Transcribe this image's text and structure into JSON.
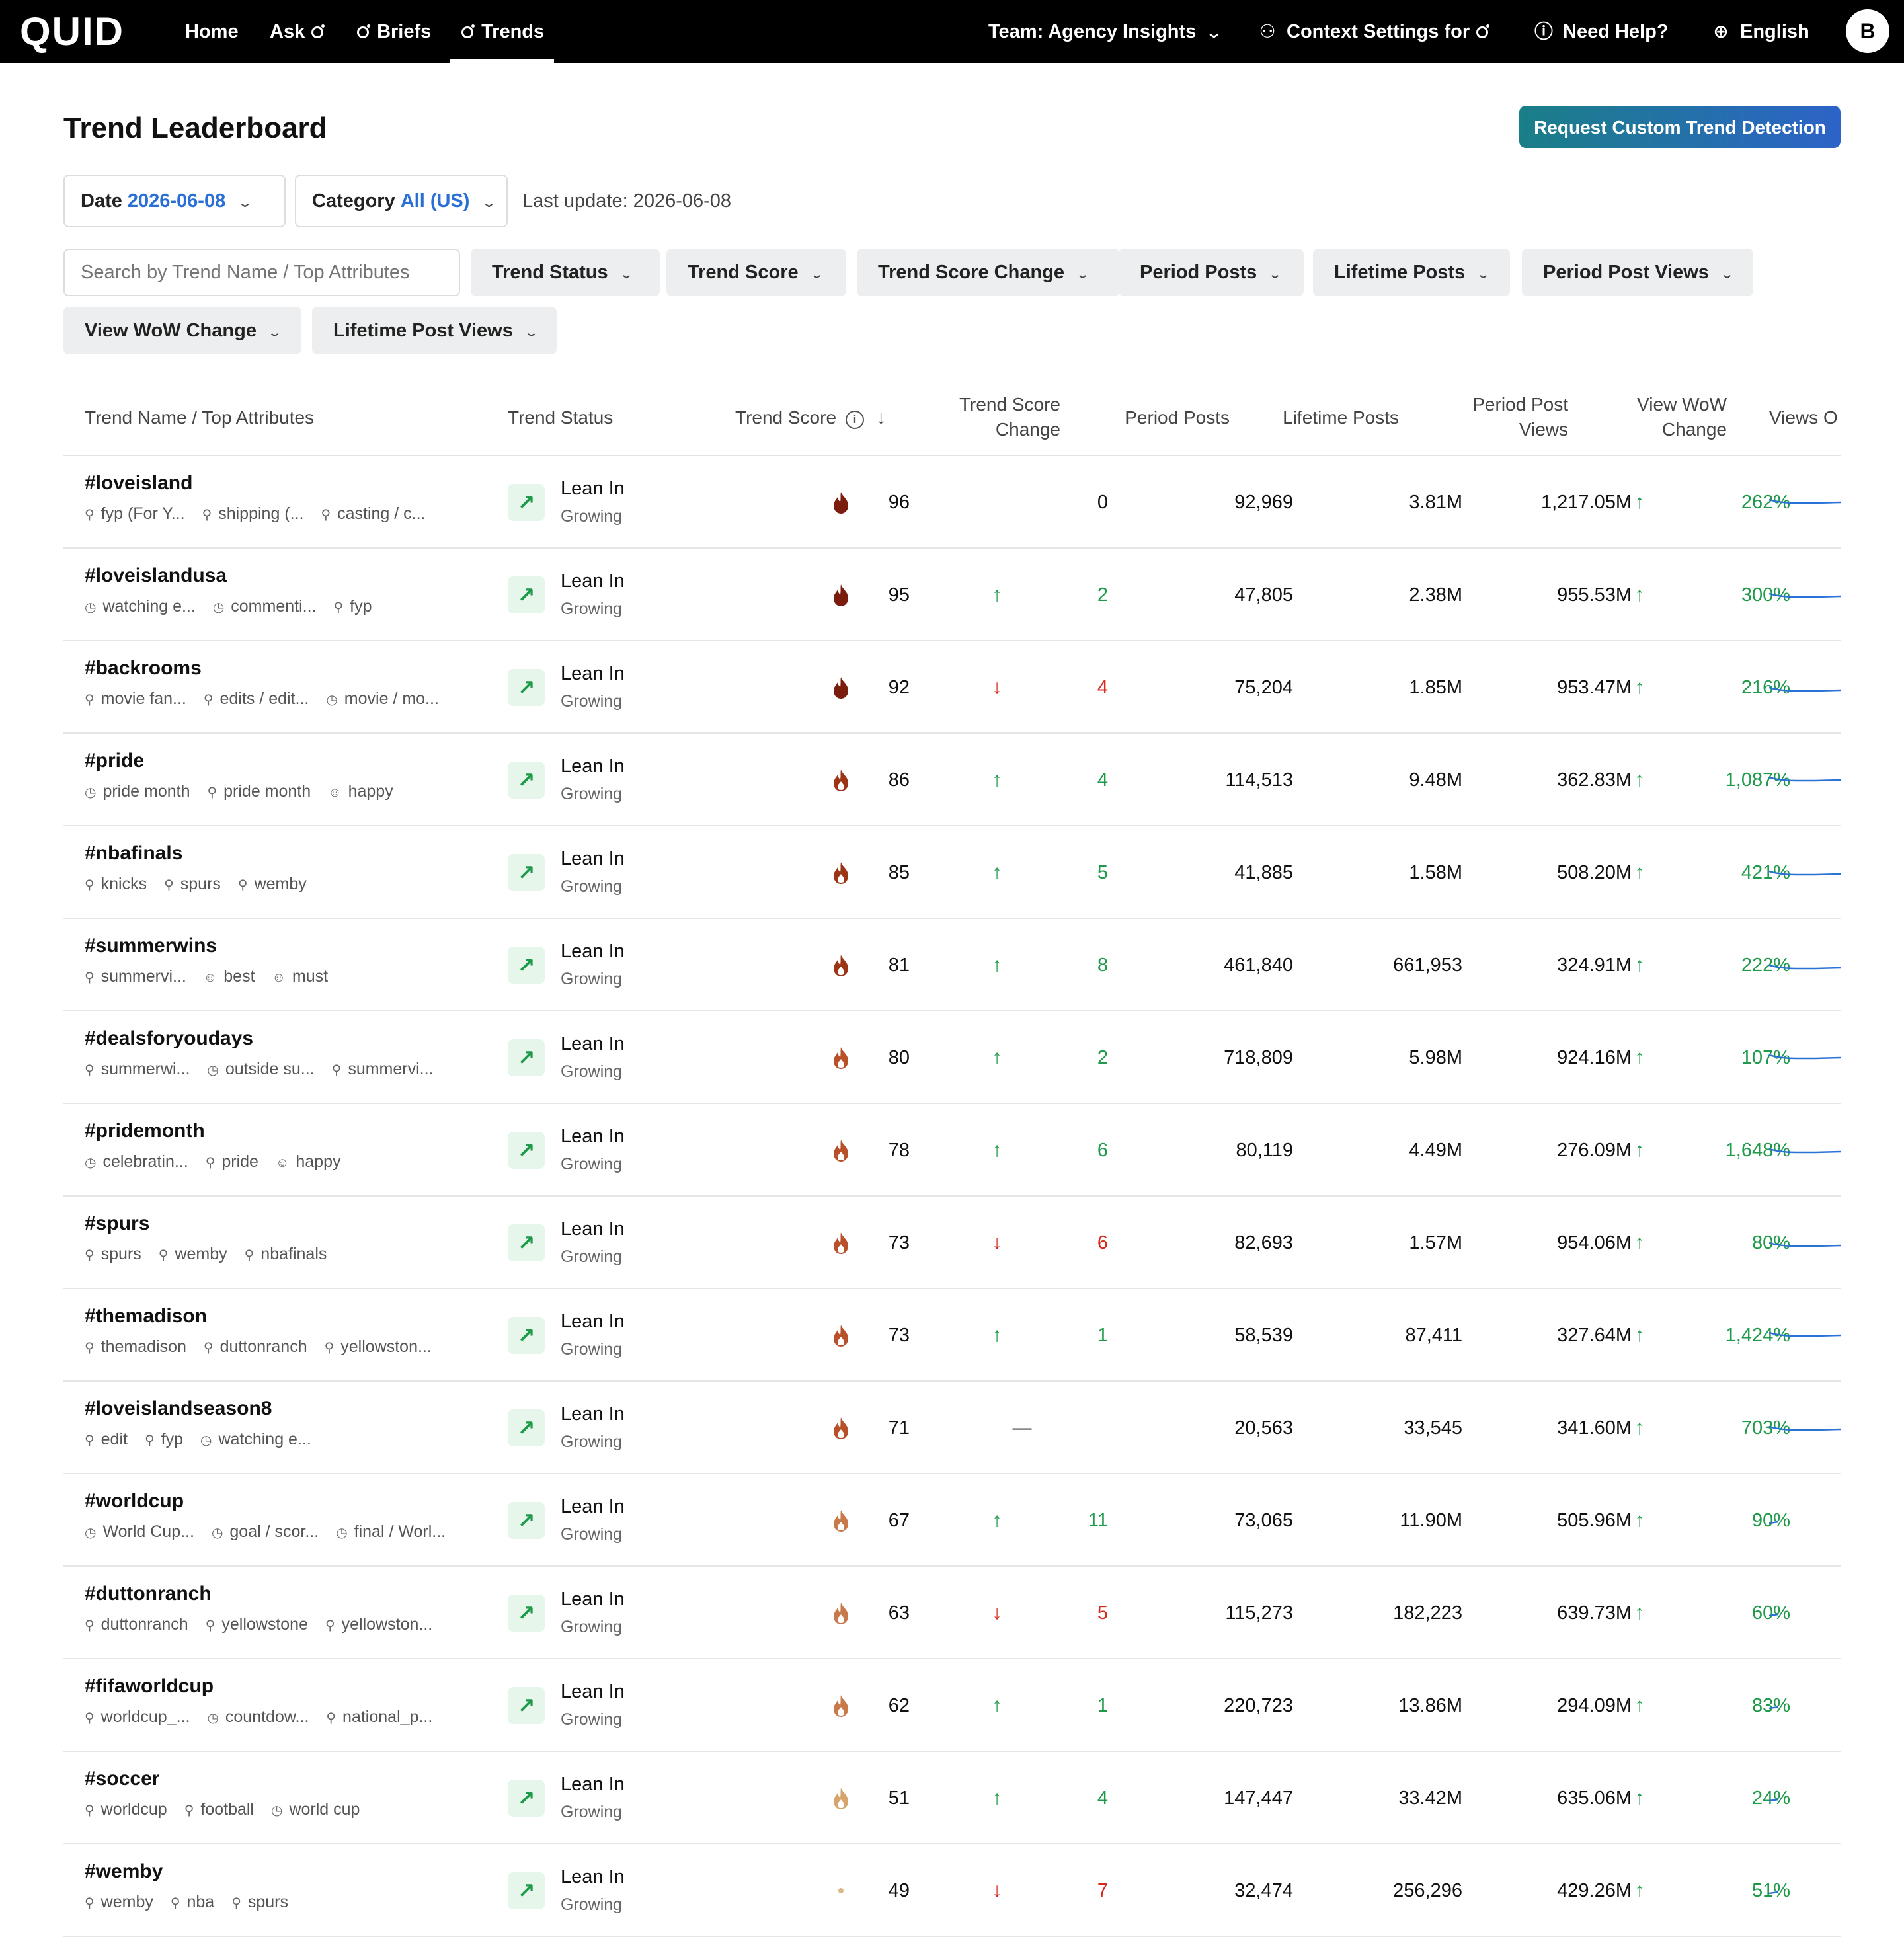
{
  "nav": {
    "logo": "QUID",
    "home": "Home",
    "ask": "Ask",
    "briefs": "Briefs",
    "trends": "Trends",
    "team": "Team: Agency Insights",
    "context": "Context Settings for",
    "help": "Need Help?",
    "language": "English",
    "avatar": "B"
  },
  "header": {
    "title": "Trend Leaderboard",
    "request_button": "Request Custom Trend Detection",
    "date_label": "Date",
    "date_value": "2026-06-08",
    "category_label": "Category",
    "category_value": "All (US)",
    "last_update": "Last update: 2026-06-08"
  },
  "filters": {
    "search_placeholder": "Search by Trend Name / Top Attributes",
    "chips": [
      "Trend Status",
      "Trend Score",
      "Trend Score Change",
      "Period Posts",
      "Lifetime Posts",
      "Period Post Views",
      "View WoW Change",
      "Lifetime Post Views"
    ]
  },
  "table": {
    "columns": {
      "name": "Trend Name / Top Attributes",
      "status": "Trend Status",
      "score": "Trend Score",
      "score_change_1": "Trend Score",
      "score_change_2": "Change",
      "period_posts": "Period Posts",
      "lifetime_posts": "Lifetime Posts",
      "period_views_1": "Period Post",
      "period_views_2": "Views",
      "wow_1": "View WoW",
      "wow_2": "Change",
      "views_over_time": "Views O"
    },
    "status_icon": "trend-up-arrow-icon",
    "colors": {
      "up": "#1e9a4a",
      "down": "#d8271c",
      "accent": "#2a6fd6",
      "spark": "#2a72d6"
    },
    "rows": [
      {
        "name": "#loveisland",
        "attrs": [
          {
            "icon": "pin",
            "text": "fyp (For Y..."
          },
          {
            "icon": "pin",
            "text": "shipping (..."
          },
          {
            "icon": "pin",
            "text": "casting / c..."
          }
        ],
        "status": "Lean In",
        "sub": "Growing",
        "score": "96",
        "dir": "none",
        "change": "0",
        "period_posts": "92,969",
        "lifetime_posts": "3.81M",
        "period_views": "1,217.05M",
        "wow": "262%",
        "heat": 1.0
      },
      {
        "name": "#loveislandusa",
        "attrs": [
          {
            "icon": "clock",
            "text": "watching e..."
          },
          {
            "icon": "clock",
            "text": "commenti..."
          },
          {
            "icon": "pin",
            "text": "fyp"
          }
        ],
        "status": "Lean In",
        "sub": "Growing",
        "score": "95",
        "dir": "up",
        "change": "2",
        "period_posts": "47,805",
        "lifetime_posts": "2.38M",
        "period_views": "955.53M",
        "wow": "300%",
        "heat": 1.0
      },
      {
        "name": "#backrooms",
        "attrs": [
          {
            "icon": "pin",
            "text": "movie fan..."
          },
          {
            "icon": "pin",
            "text": "edits / edit..."
          },
          {
            "icon": "clock",
            "text": "movie / mo..."
          }
        ],
        "status": "Lean In",
        "sub": "Growing",
        "score": "92",
        "dir": "down",
        "change": "4",
        "period_posts": "75,204",
        "lifetime_posts": "1.85M",
        "period_views": "953.47M",
        "wow": "216%",
        "heat": 1.0
      },
      {
        "name": "#pride",
        "attrs": [
          {
            "icon": "clock",
            "text": "pride month"
          },
          {
            "icon": "pin",
            "text": "pride month"
          },
          {
            "icon": "smile",
            "text": "happy"
          }
        ],
        "status": "Lean In",
        "sub": "Growing",
        "score": "86",
        "dir": "up",
        "change": "4",
        "period_posts": "114,513",
        "lifetime_posts": "9.48M",
        "period_views": "362.83M",
        "wow": "1,087%",
        "heat": 0.85
      },
      {
        "name": "#nbafinals",
        "attrs": [
          {
            "icon": "pin",
            "text": "knicks"
          },
          {
            "icon": "pin",
            "text": "spurs"
          },
          {
            "icon": "pin",
            "text": "wemby"
          }
        ],
        "status": "Lean In",
        "sub": "Growing",
        "score": "85",
        "dir": "up",
        "change": "5",
        "period_posts": "41,885",
        "lifetime_posts": "1.58M",
        "period_views": "508.20M",
        "wow": "421%",
        "heat": 0.85
      },
      {
        "name": "#summerwins",
        "attrs": [
          {
            "icon": "pin",
            "text": "summervi..."
          },
          {
            "icon": "smile",
            "text": "best"
          },
          {
            "icon": "smile",
            "text": "must"
          }
        ],
        "status": "Lean In",
        "sub": "Growing",
        "score": "81",
        "dir": "up",
        "change": "8",
        "period_posts": "461,840",
        "lifetime_posts": "661,953",
        "period_views": "324.91M",
        "wow": "222%",
        "heat": 0.8
      },
      {
        "name": "#dealsforyoudays",
        "attrs": [
          {
            "icon": "pin",
            "text": "summerwi..."
          },
          {
            "icon": "clock",
            "text": "outside su..."
          },
          {
            "icon": "pin",
            "text": "summervi..."
          }
        ],
        "status": "Lean In",
        "sub": "Growing",
        "score": "80",
        "dir": "up",
        "change": "2",
        "period_posts": "718,809",
        "lifetime_posts": "5.98M",
        "period_views": "924.16M",
        "wow": "107%",
        "heat": 0.7
      },
      {
        "name": "#pridemonth",
        "attrs": [
          {
            "icon": "clock",
            "text": "celebratin..."
          },
          {
            "icon": "pin",
            "text": "pride"
          },
          {
            "icon": "smile",
            "text": "happy"
          }
        ],
        "status": "Lean In",
        "sub": "Growing",
        "score": "78",
        "dir": "up",
        "change": "6",
        "period_posts": "80,119",
        "lifetime_posts": "4.49M",
        "period_views": "276.09M",
        "wow": "1,648%",
        "heat": 0.7
      },
      {
        "name": "#spurs",
        "attrs": [
          {
            "icon": "pin",
            "text": "spurs"
          },
          {
            "icon": "pin",
            "text": "wemby"
          },
          {
            "icon": "pin",
            "text": "nbafinals"
          }
        ],
        "status": "Lean In",
        "sub": "Growing",
        "score": "73",
        "dir": "down",
        "change": "6",
        "period_posts": "82,693",
        "lifetime_posts": "1.57M",
        "period_views": "954.06M",
        "wow": "80%",
        "heat": 0.65
      },
      {
        "name": "#themadison",
        "attrs": [
          {
            "icon": "pin",
            "text": "themadison"
          },
          {
            "icon": "pin",
            "text": "duttonranch"
          },
          {
            "icon": "pin",
            "text": "yellowston..."
          }
        ],
        "status": "Lean In",
        "sub": "Growing",
        "score": "73",
        "dir": "up",
        "change": "1",
        "period_posts": "58,539",
        "lifetime_posts": "87,411",
        "period_views": "327.64M",
        "wow": "1,424%",
        "heat": 0.65
      },
      {
        "name": "#loveislandseason8",
        "attrs": [
          {
            "icon": "pin",
            "text": "edit"
          },
          {
            "icon": "pin",
            "text": "fyp"
          },
          {
            "icon": "clock",
            "text": "watching e..."
          }
        ],
        "status": "Lean In",
        "sub": "Growing",
        "score": "71",
        "dir": "none",
        "change": "—",
        "period_posts": "20,563",
        "lifetime_posts": "33,545",
        "period_views": "341.60M",
        "wow": "703%",
        "heat": 0.65
      },
      {
        "name": "#worldcup",
        "attrs": [
          {
            "icon": "clock",
            "text": "World Cup..."
          },
          {
            "icon": "clock",
            "text": "goal / scor..."
          },
          {
            "icon": "clock",
            "text": "final / Worl..."
          }
        ],
        "status": "Lean In",
        "sub": "Growing",
        "score": "67",
        "dir": "up",
        "change": "11",
        "period_posts": "73,065",
        "lifetime_posts": "11.90M",
        "period_views": "505.96M",
        "wow": "90%",
        "heat": 0.5
      },
      {
        "name": "#duttonranch",
        "attrs": [
          {
            "icon": "pin",
            "text": "duttonranch"
          },
          {
            "icon": "pin",
            "text": "yellowstone"
          },
          {
            "icon": "pin",
            "text": "yellowston..."
          }
        ],
        "status": "Lean In",
        "sub": "Growing",
        "score": "63",
        "dir": "down",
        "change": "5",
        "period_posts": "115,273",
        "lifetime_posts": "182,223",
        "period_views": "639.73M",
        "wow": "60%",
        "heat": 0.5
      },
      {
        "name": "#fifaworldcup",
        "attrs": [
          {
            "icon": "pin",
            "text": "worldcup_..."
          },
          {
            "icon": "clock",
            "text": "countdow..."
          },
          {
            "icon": "pin",
            "text": "national_p..."
          }
        ],
        "status": "Lean In",
        "sub": "Growing",
        "score": "62",
        "dir": "up",
        "change": "1",
        "period_posts": "220,723",
        "lifetime_posts": "13.86M",
        "period_views": "294.09M",
        "wow": "83%",
        "heat": 0.5
      },
      {
        "name": "#soccer",
        "attrs": [
          {
            "icon": "pin",
            "text": "worldcup"
          },
          {
            "icon": "pin",
            "text": "football"
          },
          {
            "icon": "clock",
            "text": "world cup"
          }
        ],
        "status": "Lean In",
        "sub": "Growing",
        "score": "51",
        "dir": "up",
        "change": "4",
        "period_posts": "147,447",
        "lifetime_posts": "33.42M",
        "period_views": "635.06M",
        "wow": "24%",
        "heat": 0.35
      },
      {
        "name": "#wemby",
        "attrs": [
          {
            "icon": "pin",
            "text": "wemby"
          },
          {
            "icon": "pin",
            "text": "nba"
          },
          {
            "icon": "pin",
            "text": "spurs"
          }
        ],
        "status": "Lean In",
        "sub": "Growing",
        "score": "49",
        "dir": "down",
        "change": "7",
        "period_posts": "32,474",
        "lifetime_posts": "256,296",
        "period_views": "429.26M",
        "wow": "51%",
        "heat": 0.1
      }
    ]
  }
}
